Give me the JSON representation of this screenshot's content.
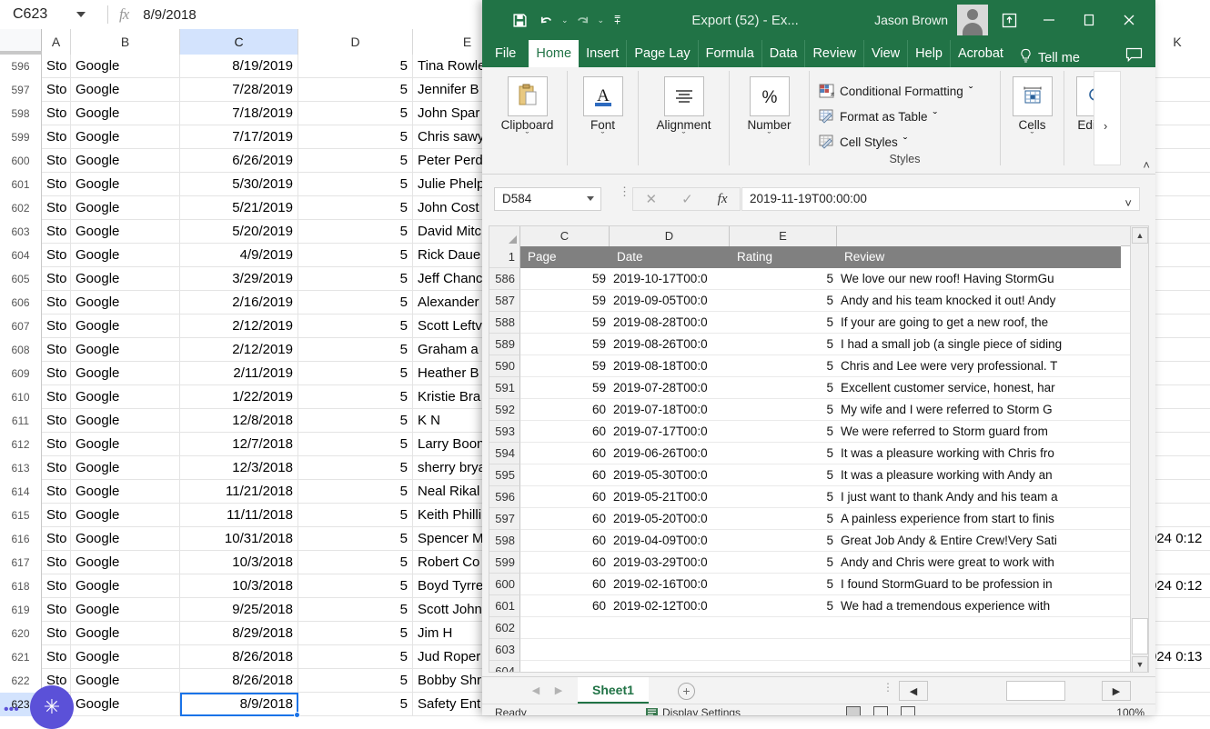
{
  "background_app": {
    "name": "google-sheets",
    "namebox_value": "C623",
    "formula_value": "8/9/2018",
    "fx_symbol": "fx",
    "column_headers": [
      "A",
      "B",
      "C",
      "D",
      "E"
    ],
    "selected_column": "C",
    "rows": [
      {
        "n": "596",
        "a": "Sto",
        "b": "Google",
        "c": "8/19/2019",
        "d": "5",
        "e": "Tina Rowle",
        "k": ""
      },
      {
        "n": "597",
        "a": "Sto",
        "b": "Google",
        "c": "7/28/2019",
        "d": "5",
        "e": "Jennifer B",
        "k": ""
      },
      {
        "n": "598",
        "a": "Sto",
        "b": "Google",
        "c": "7/18/2019",
        "d": "5",
        "e": "John Spar",
        "k": ""
      },
      {
        "n": "599",
        "a": "Sto",
        "b": "Google",
        "c": "7/17/2019",
        "d": "5",
        "e": "Chris sawy",
        "k": ""
      },
      {
        "n": "600",
        "a": "Sto",
        "b": "Google",
        "c": "6/26/2019",
        "d": "5",
        "e": "Peter Perd",
        "k": ""
      },
      {
        "n": "601",
        "a": "Sto",
        "b": "Google",
        "c": "5/30/2019",
        "d": "5",
        "e": "Julie Phelp",
        "k": ""
      },
      {
        "n": "602",
        "a": "Sto",
        "b": "Google",
        "c": "5/21/2019",
        "d": "5",
        "e": "John Cost",
        "k": ""
      },
      {
        "n": "603",
        "a": "Sto",
        "b": "Google",
        "c": "5/20/2019",
        "d": "5",
        "e": "David Mitc",
        "k": ""
      },
      {
        "n": "604",
        "a": "Sto",
        "b": "Google",
        "c": "4/9/2019",
        "d": "5",
        "e": "Rick Daue",
        "k": ""
      },
      {
        "n": "605",
        "a": "Sto",
        "b": "Google",
        "c": "3/29/2019",
        "d": "5",
        "e": "Jeff Chanc",
        "k": ""
      },
      {
        "n": "606",
        "a": "Sto",
        "b": "Google",
        "c": "2/16/2019",
        "d": "5",
        "e": "Alexander",
        "k": ""
      },
      {
        "n": "607",
        "a": "Sto",
        "b": "Google",
        "c": "2/12/2019",
        "d": "5",
        "e": "Scott Leftv",
        "k": ""
      },
      {
        "n": "608",
        "a": "Sto",
        "b": "Google",
        "c": "2/12/2019",
        "d": "5",
        "e": "Graham a",
        "k": ""
      },
      {
        "n": "609",
        "a": "Sto",
        "b": "Google",
        "c": "2/11/2019",
        "d": "5",
        "e": "Heather B",
        "k": ""
      },
      {
        "n": "610",
        "a": "Sto",
        "b": "Google",
        "c": "1/22/2019",
        "d": "5",
        "e": "Kristie Bra",
        "k": ""
      },
      {
        "n": "611",
        "a": "Sto",
        "b": "Google",
        "c": "12/8/2018",
        "d": "5",
        "e": "K N",
        "k": ""
      },
      {
        "n": "612",
        "a": "Sto",
        "b": "Google",
        "c": "12/7/2018",
        "d": "5",
        "e": "Larry Boon",
        "k": ""
      },
      {
        "n": "613",
        "a": "Sto",
        "b": "Google",
        "c": "12/3/2018",
        "d": "5",
        "e": "sherry brya",
        "k": ""
      },
      {
        "n": "614",
        "a": "Sto",
        "b": "Google",
        "c": "11/21/2018",
        "d": "5",
        "e": "Neal Rikal",
        "k": ""
      },
      {
        "n": "615",
        "a": "Sto",
        "b": "Google",
        "c": "11/11/2018",
        "d": "5",
        "e": "Keith Philli",
        "k": ""
      },
      {
        "n": "616",
        "a": "Sto",
        "b": "Google",
        "c": "10/31/2018",
        "d": "5",
        "e": "Spencer M",
        "k": "024 0:12"
      },
      {
        "n": "617",
        "a": "Sto",
        "b": "Google",
        "c": "10/3/2018",
        "d": "5",
        "e": "Robert Co",
        "k": ""
      },
      {
        "n": "618",
        "a": "Sto",
        "b": "Google",
        "c": "10/3/2018",
        "d": "5",
        "e": "Boyd Tyrre",
        "k": "024 0:12"
      },
      {
        "n": "619",
        "a": "Sto",
        "b": "Google",
        "c": "9/25/2018",
        "d": "5",
        "e": "Scott John",
        "k": ""
      },
      {
        "n": "620",
        "a": "Sto",
        "b": "Google",
        "c": "8/29/2018",
        "d": "5",
        "e": "Jim H",
        "k": ""
      },
      {
        "n": "621",
        "a": "Sto",
        "b": "Google",
        "c": "8/26/2018",
        "d": "5",
        "e": "Jud Roper",
        "k": "024 0:13"
      },
      {
        "n": "622",
        "a": "Sto",
        "b": "Google",
        "c": "8/26/2018",
        "d": "5",
        "e": "Bobby Shr",
        "k": ""
      },
      {
        "n": "623",
        "a": "",
        "b": "Google",
        "c": "8/9/2018",
        "d": "5",
        "e": "Safety Ent",
        "k": ""
      }
    ],
    "partial_column_letter_right": "K",
    "loading_indicator": "loading-spinner"
  },
  "excel": {
    "titlebar": {
      "save_icon": "save-icon",
      "undo_icon": "undo-icon",
      "redo_icon": "redo-icon",
      "customize_icon": "customize-quick-access-icon",
      "title": "Export (52)  -  Ex...",
      "user_name": "Jason Brown",
      "avatar": "user-avatar",
      "ribbon_display_icon": "ribbon-display-options-icon",
      "minimize": "minimize-icon",
      "restore": "restore-icon",
      "close": "close-icon"
    },
    "tabs": [
      {
        "label": "File",
        "active": false
      },
      {
        "label": "Home",
        "active": true
      },
      {
        "label": "Insert",
        "active": false
      },
      {
        "label": "Page Lay",
        "active": false
      },
      {
        "label": "Formula",
        "active": false
      },
      {
        "label": "Data",
        "active": false
      },
      {
        "label": "Review",
        "active": false
      },
      {
        "label": "View",
        "active": false
      },
      {
        "label": "Help",
        "active": false
      },
      {
        "label": "Acrobat",
        "active": false
      }
    ],
    "tellme": {
      "icon": "lightbulb-icon",
      "label": "Tell me"
    },
    "comment_icon": "comment-icon",
    "ribbon": {
      "groups": [
        {
          "label": "Clipboard",
          "icon": "clipboard-icon",
          "chevron": "ˇ"
        },
        {
          "label": "Font",
          "icon": "font-color-icon",
          "chevron": "ˇ"
        },
        {
          "label": "Alignment",
          "icon": "alignment-icon",
          "chevron": "ˇ"
        },
        {
          "label": "Number",
          "icon": "percent-icon",
          "chevron": "ˇ"
        }
      ],
      "styles": {
        "group_label": "Styles",
        "items": [
          {
            "label": "Conditional Formatting",
            "icon": "conditional-formatting-icon",
            "caret": "ˇ"
          },
          {
            "label": "Format as Table",
            "icon": "format-as-table-icon",
            "caret": "ˇ"
          },
          {
            "label": "Cell Styles",
            "icon": "cell-styles-icon",
            "caret": "ˇ"
          }
        ]
      },
      "cells": {
        "label": "Cells",
        "icon": "cells-icon",
        "chevron": "ˇ"
      },
      "editing": {
        "label": "Editing",
        "icon": "find-select-icon",
        "chevron": "ˇ"
      },
      "overflow_caret": "›",
      "collapse_caret": "˄"
    },
    "formula_bar": {
      "namebox_value": "D584",
      "cancel_icon": "cancel-icon",
      "enter_icon": "enter-icon",
      "fx_icon": "fx",
      "value": "2019-11-19T00:00:00",
      "expand_caret": "˅"
    },
    "grid": {
      "column_headers": [
        "C",
        "D",
        "E"
      ],
      "header_row_number": "1",
      "headers": {
        "page": "Page",
        "date": "Date",
        "rating": "Rating",
        "review": "Review"
      },
      "rows": [
        {
          "n": "586",
          "page": "59",
          "date": "2019-10-17T00:0",
          "rating": "5",
          "review": "We love our new roof! Having StormGu"
        },
        {
          "n": "587",
          "page": "59",
          "date": "2019-09-05T00:0",
          "rating": "5",
          "review": "Andy and his team knocked it out! Andy"
        },
        {
          "n": "588",
          "page": "59",
          "date": "2019-08-28T00:0",
          "rating": "5",
          "review": "If your are going to get a new roof, the"
        },
        {
          "n": "589",
          "page": "59",
          "date": "2019-08-26T00:0",
          "rating": "5",
          "review": "I had a small job (a single piece of siding"
        },
        {
          "n": "590",
          "page": "59",
          "date": "2019-08-18T00:0",
          "rating": "5",
          "review": "Chris and Lee were very professional.  T"
        },
        {
          "n": "591",
          "page": "59",
          "date": "2019-07-28T00:0",
          "rating": "5",
          "review": "Excellent customer service, honest, har"
        },
        {
          "n": "592",
          "page": "60",
          "date": "2019-07-18T00:0",
          "rating": "5",
          "review": "My wife and I were referred to Storm G"
        },
        {
          "n": "593",
          "page": "60",
          "date": "2019-07-17T00:0",
          "rating": "5",
          "review": "We were referred to Storm guard from"
        },
        {
          "n": "594",
          "page": "60",
          "date": "2019-06-26T00:0",
          "rating": "5",
          "review": "It was a pleasure working with Chris fro"
        },
        {
          "n": "595",
          "page": "60",
          "date": "2019-05-30T00:0",
          "rating": "5",
          "review": "It was a pleasure working with Andy an"
        },
        {
          "n": "596",
          "page": "60",
          "date": "2019-05-21T00:0",
          "rating": "5",
          "review": "I just want to thank Andy and his team a"
        },
        {
          "n": "597",
          "page": "60",
          "date": "2019-05-20T00:0",
          "rating": "5",
          "review": "A painless experience from start to finis"
        },
        {
          "n": "598",
          "page": "60",
          "date": "2019-04-09T00:0",
          "rating": "5",
          "review": "Great Job Andy & Entire Crew!Very Sati"
        },
        {
          "n": "599",
          "page": "60",
          "date": "2019-03-29T00:0",
          "rating": "5",
          "review": "Andy and Chris were great to work with"
        },
        {
          "n": "600",
          "page": "60",
          "date": "2019-02-16T00:0",
          "rating": "5",
          "review": "I found StormGuard to be profession in"
        },
        {
          "n": "601",
          "page": "60",
          "date": "2019-02-12T00:0",
          "rating": "5",
          "review": "We had a tremendous experience with"
        },
        {
          "n": "602",
          "page": "",
          "date": "",
          "rating": "",
          "review": ""
        },
        {
          "n": "603",
          "page": "",
          "date": "",
          "rating": "",
          "review": ""
        },
        {
          "n": "604",
          "page": "",
          "date": "",
          "rating": "",
          "review": ""
        }
      ]
    },
    "sheetbar": {
      "prev_icon": "previous-sheet-icon",
      "next_icon": "next-sheet-icon",
      "sheet_name": "Sheet1",
      "add_sheet_icon": "add-sheet-icon",
      "hsb_left_icon": "scroll-left-icon",
      "hsb_right_icon": "scroll-right-icon"
    },
    "status": {
      "ready": "Ready",
      "display_settings": "Display Settings",
      "zoom": "100%"
    },
    "colors": {
      "brand_green": "#217346",
      "header_gray": "#808080",
      "sheets_blue": "#1a73e8"
    }
  }
}
